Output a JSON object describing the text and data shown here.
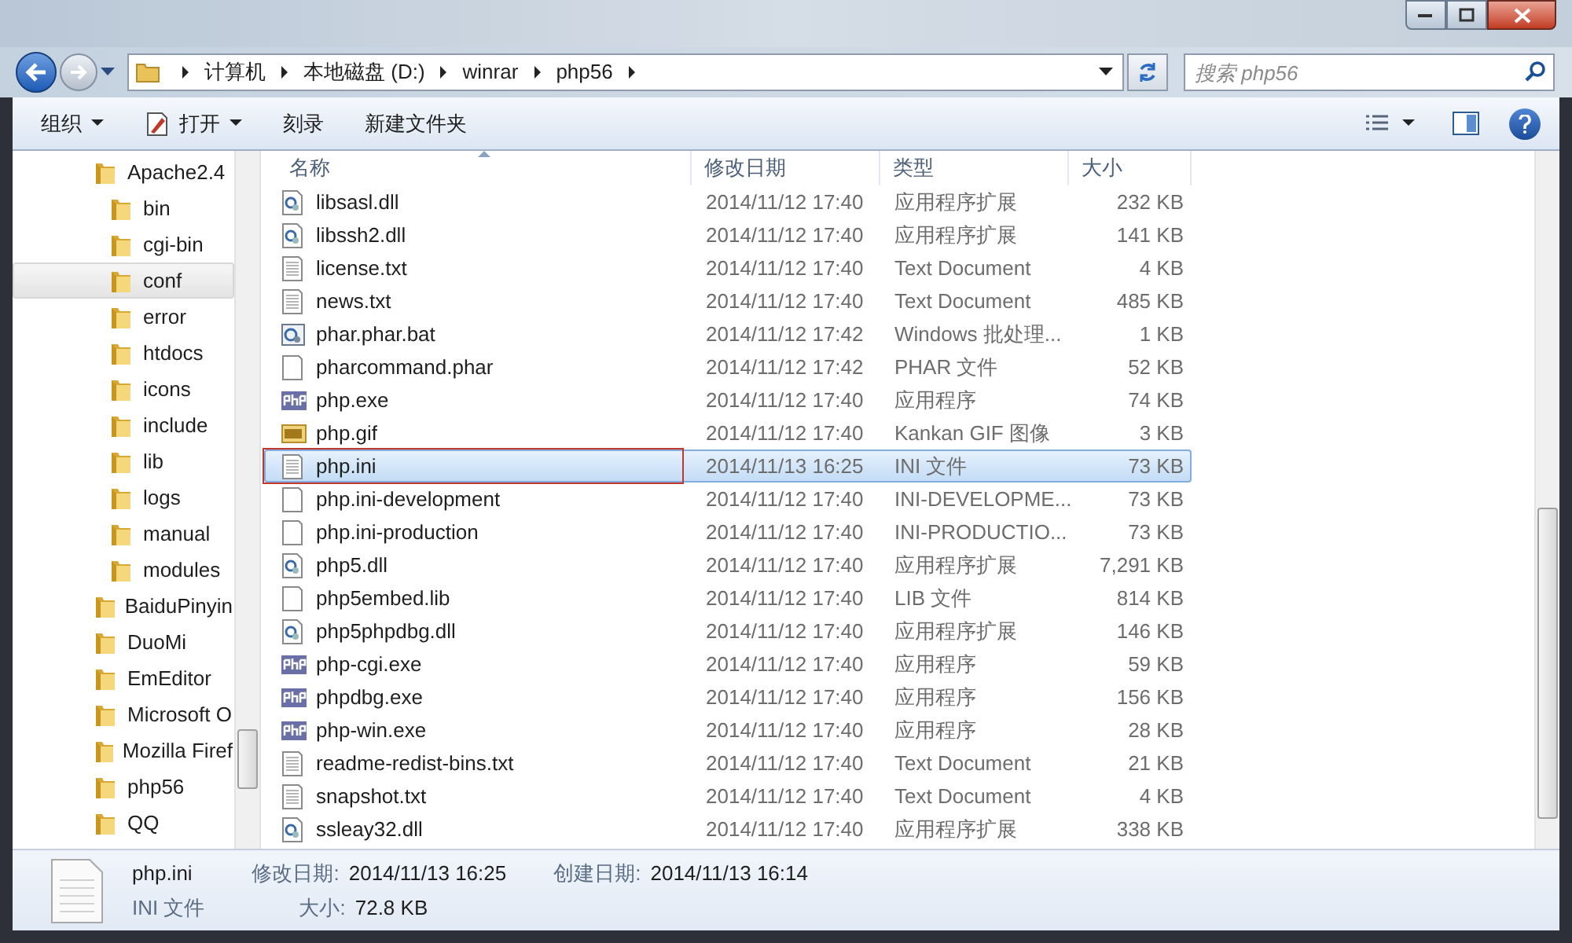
{
  "address_bar": {
    "segments": [
      "计算机",
      "本地磁盘 (D:)",
      "winrar",
      "php56"
    ]
  },
  "search": {
    "placeholder": "搜索 php56"
  },
  "toolbar": {
    "items": [
      {
        "label": "组织",
        "dropdown": true
      },
      {
        "label": "打开",
        "dropdown": true
      },
      {
        "label": "刻录",
        "dropdown": false
      },
      {
        "label": "新建文件夹",
        "dropdown": false
      }
    ]
  },
  "nav_tree": [
    {
      "label": "Apache2.4",
      "selected": false,
      "children": [
        {
          "label": "bin",
          "selected": false
        },
        {
          "label": "cgi-bin",
          "selected": false
        },
        {
          "label": "conf",
          "selected": true
        },
        {
          "label": "error",
          "selected": false
        },
        {
          "label": "htdocs",
          "selected": false
        },
        {
          "label": "icons",
          "selected": false
        },
        {
          "label": "include",
          "selected": false
        },
        {
          "label": "lib",
          "selected": false
        },
        {
          "label": "logs",
          "selected": false
        },
        {
          "label": "manual",
          "selected": false
        },
        {
          "label": "modules",
          "selected": false
        }
      ]
    },
    {
      "label": "BaiduPinyin",
      "selected": false
    },
    {
      "label": "DuoMi",
      "selected": false
    },
    {
      "label": "EmEditor",
      "selected": false
    },
    {
      "label": "Microsoft O",
      "selected": false
    },
    {
      "label": "Mozilla Firef",
      "selected": false
    },
    {
      "label": "php56",
      "selected": false
    },
    {
      "label": "QQ",
      "selected": false
    }
  ],
  "file_list": {
    "columns": [
      "名称",
      "修改日期",
      "类型",
      "大小"
    ],
    "rows": [
      {
        "kind": "dll",
        "name": "libsasl.dll",
        "date": "2014/11/12 17:40",
        "type": "应用程序扩展",
        "size": "232 KB",
        "selected": false,
        "marked": false
      },
      {
        "kind": "dll",
        "name": "libssh2.dll",
        "date": "2014/11/12 17:40",
        "type": "应用程序扩展",
        "size": "141 KB",
        "selected": false,
        "marked": false
      },
      {
        "kind": "text",
        "name": "license.txt",
        "date": "2014/11/12 17:40",
        "type": "Text Document",
        "size": "4 KB",
        "selected": false,
        "marked": false
      },
      {
        "kind": "text",
        "name": "news.txt",
        "date": "2014/11/12 17:40",
        "type": "Text Document",
        "size": "485 KB",
        "selected": false,
        "marked": false
      },
      {
        "kind": "batch",
        "name": "phar.phar.bat",
        "date": "2014/11/12 17:42",
        "type": "Windows 批处理...",
        "size": "1 KB",
        "selected": false,
        "marked": false
      },
      {
        "kind": "blank",
        "name": "pharcommand.phar",
        "date": "2014/11/12 17:42",
        "type": "PHAR 文件",
        "size": "52 KB",
        "selected": false,
        "marked": false
      },
      {
        "kind": "php",
        "name": "php.exe",
        "date": "2014/11/12 17:40",
        "type": "应用程序",
        "size": "74 KB",
        "selected": false,
        "marked": false
      },
      {
        "kind": "gif",
        "name": "php.gif",
        "date": "2014/11/12 17:40",
        "type": "Kankan GIF 图像",
        "size": "3 KB",
        "selected": false,
        "marked": false
      },
      {
        "kind": "text",
        "name": "php.ini",
        "date": "2014/11/13 16:25",
        "type": "INI 文件",
        "size": "73 KB",
        "selected": true,
        "marked": true
      },
      {
        "kind": "blank",
        "name": "php.ini-development",
        "date": "2014/11/12 17:40",
        "type": "INI-DEVELOPME...",
        "size": "73 KB",
        "selected": false,
        "marked": false
      },
      {
        "kind": "blank",
        "name": "php.ini-production",
        "date": "2014/11/12 17:40",
        "type": "INI-PRODUCTIO...",
        "size": "73 KB",
        "selected": false,
        "marked": false
      },
      {
        "kind": "dll",
        "name": "php5.dll",
        "date": "2014/11/12 17:40",
        "type": "应用程序扩展",
        "size": "7,291 KB",
        "selected": false,
        "marked": false
      },
      {
        "kind": "blank",
        "name": "php5embed.lib",
        "date": "2014/11/12 17:40",
        "type": "LIB 文件",
        "size": "814 KB",
        "selected": false,
        "marked": false
      },
      {
        "kind": "dll",
        "name": "php5phpdbg.dll",
        "date": "2014/11/12 17:40",
        "type": "应用程序扩展",
        "size": "146 KB",
        "selected": false,
        "marked": false
      },
      {
        "kind": "php",
        "name": "php-cgi.exe",
        "date": "2014/11/12 17:40",
        "type": "应用程序",
        "size": "59 KB",
        "selected": false,
        "marked": false
      },
      {
        "kind": "php",
        "name": "phpdbg.exe",
        "date": "2014/11/12 17:40",
        "type": "应用程序",
        "size": "156 KB",
        "selected": false,
        "marked": false
      },
      {
        "kind": "php",
        "name": "php-win.exe",
        "date": "2014/11/12 17:40",
        "type": "应用程序",
        "size": "28 KB",
        "selected": false,
        "marked": false
      },
      {
        "kind": "text",
        "name": "readme-redist-bins.txt",
        "date": "2014/11/12 17:40",
        "type": "Text Document",
        "size": "21 KB",
        "selected": false,
        "marked": false
      },
      {
        "kind": "text",
        "name": "snapshot.txt",
        "date": "2014/11/12 17:40",
        "type": "Text Document",
        "size": "4 KB",
        "selected": false,
        "marked": false
      },
      {
        "kind": "dll",
        "name": "ssleay32.dll",
        "date": "2014/11/12 17:40",
        "type": "应用程序扩展",
        "size": "338 KB",
        "selected": false,
        "marked": false
      }
    ]
  },
  "details_pane": {
    "name": "php.ini",
    "type": "INI 文件",
    "fields": [
      {
        "label": "修改日期:",
        "value": "2014/11/13 16:25"
      },
      {
        "label": "大小:",
        "value": "72.8 KB"
      },
      {
        "label": "创建日期:",
        "value": "2014/11/13 16:14"
      }
    ]
  }
}
